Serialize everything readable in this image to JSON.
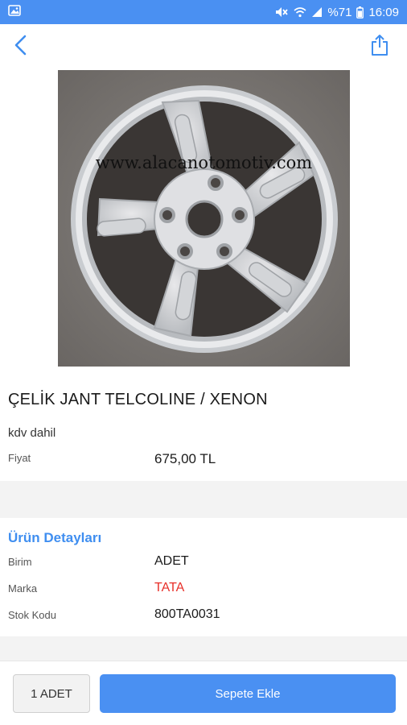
{
  "status_bar": {
    "battery": "%71",
    "time": "16:09",
    "icons": [
      "image-icon",
      "mute-icon",
      "wifi-icon",
      "signal-icon",
      "battery-icon"
    ]
  },
  "app_bar": {
    "back_icon": "chevron-left-icon",
    "share_icon": "share-icon"
  },
  "product": {
    "image_subject": "alloy-wheel-rim",
    "watermark": "www.alacanotomotiv.com",
    "title": "ÇELİK JANT TELCOLINE / XENON",
    "vat_note": "kdv dahil",
    "price_label": "Fiyat",
    "price_value": "675,00 TL"
  },
  "details": {
    "section_title": "Ürün Detayları",
    "rows": [
      {
        "label": "Birim",
        "value": "ADET"
      },
      {
        "label": "Marka",
        "value": "TATA"
      },
      {
        "label": "Stok Kodu",
        "value": "800TA0031"
      }
    ],
    "brand_color": "#e8302a"
  },
  "actions": {
    "quantity_label": "1 ADET",
    "add_to_cart_label": "Sepete Ekle"
  },
  "colors": {
    "accent": "#4a90f2",
    "section_title": "#3f8ef0"
  }
}
